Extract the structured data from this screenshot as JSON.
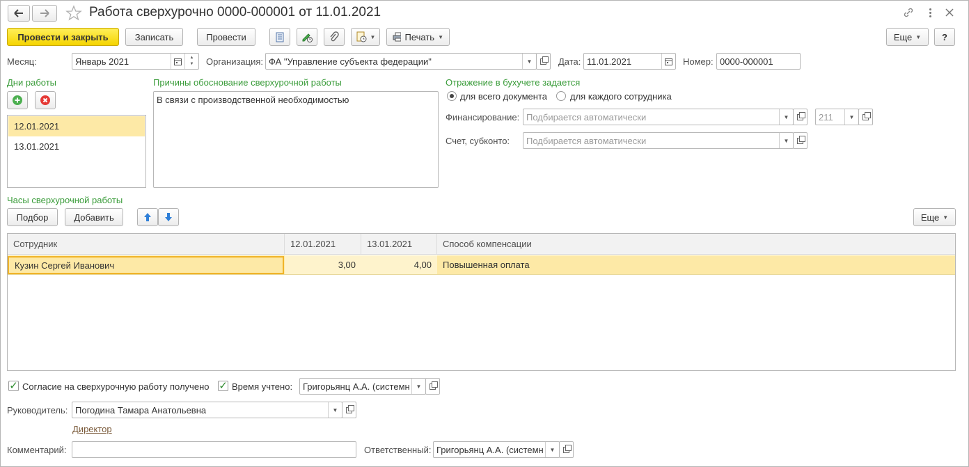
{
  "window": {
    "title": "Работа сверхурочно 0000-000001 от 11.01.2021"
  },
  "toolbar": {
    "post_close_label": "Провести и закрыть",
    "save_label": "Записать",
    "post_label": "Провести",
    "print_label": "Печать",
    "more_label": "Еще",
    "help_label": "?"
  },
  "header": {
    "month_label": "Месяц:",
    "month_value": "Январь 2021",
    "org_label": "Организация:",
    "org_value": "ФА \"Управление субъекта федерации\"",
    "date_label": "Дата:",
    "date_value": "11.01.2021",
    "number_label": "Номер:",
    "number_value": "0000-000001"
  },
  "work_days": {
    "title": "Дни работы",
    "items": [
      "12.01.2021",
      "13.01.2021"
    ]
  },
  "reasons": {
    "title": "Причины обоснование сверхурочной работы",
    "text": "В связи с производственной необходимостью"
  },
  "accounting": {
    "title": "Отражение в бухучете задается",
    "option_document": "для всего документа",
    "option_employee": "для каждого сотрудника",
    "financing_label": "Финансирование:",
    "financing_placeholder": "Подбирается автоматически",
    "financing_code": "211",
    "account_label": "Счет, субконто:",
    "account_placeholder": "Подбирается автоматически"
  },
  "hours": {
    "title": "Часы сверхурочной работы",
    "pick_label": "Подбор",
    "add_label": "Добавить",
    "more_label": "Еще",
    "columns": [
      "Сотрудник",
      "12.01.2021",
      "13.01.2021",
      "Способ компенсации"
    ],
    "rows": [
      {
        "employee": "Кузин Сергей Иванович",
        "d1": "3,00",
        "d2": "4,00",
        "compensation": "Повышенная оплата"
      }
    ]
  },
  "footer": {
    "consent_label": "Согласие на сверхурочную работу получено",
    "time_label": "Время учтено:",
    "time_value": "Григорьянц А.А. (системн",
    "head_label": "Руководитель:",
    "head_value": "Погодина Тамара Анатольевна",
    "head_position": "Директор",
    "comment_label": "Комментарий:",
    "comment_value": "",
    "responsible_label": "Ответственный:",
    "responsible_value": "Григорьянц А.А. (системн"
  },
  "colors": {
    "accent_yellow": "#f5d400",
    "selected_row": "#fde9a6",
    "group_title_green": "#3a9c3a"
  }
}
